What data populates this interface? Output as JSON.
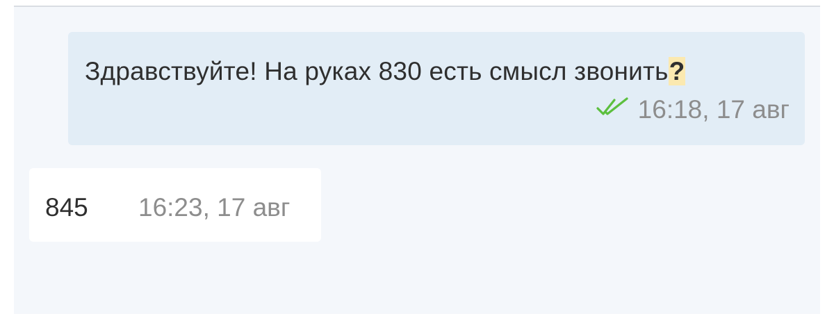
{
  "messages": [
    {
      "direction": "outgoing",
      "text": "Здравствуйте! На руках 830 есть смысл звонить",
      "highlight": "?",
      "time": "16:18, 17 авг",
      "status_icon": "double-check-icon",
      "status_color": "#5cbf3e"
    },
    {
      "direction": "incoming",
      "text": "845",
      "time": "16:23, 17 авг"
    }
  ],
  "colors": {
    "chat_background": "#f4f7fb",
    "outgoing_bubble": "#e2edf6",
    "incoming_bubble": "#ffffff",
    "highlight": "#fbe9b0"
  }
}
